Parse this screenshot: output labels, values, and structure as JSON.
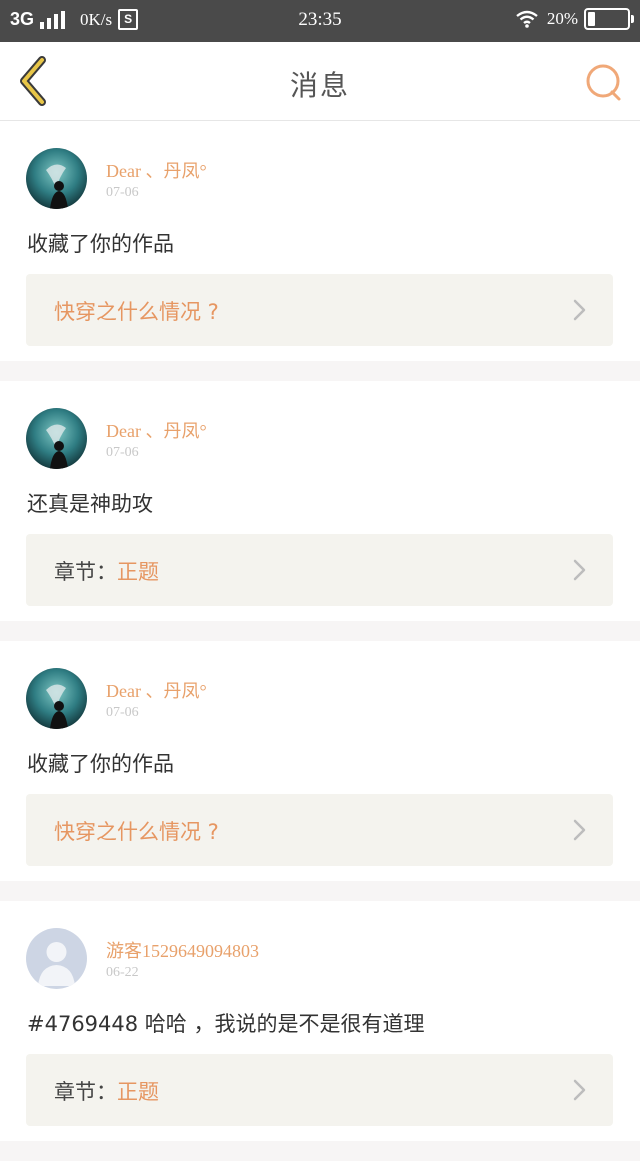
{
  "status_bar": {
    "network": "3G",
    "speed": "0K/s",
    "s_badge": "S",
    "time": "23:35",
    "battery_text": "20%",
    "battery_level": 0.2
  },
  "header": {
    "title": "消息",
    "back_icon": "chevron-left-icon",
    "search_icon": "search-icon"
  },
  "colors": {
    "accent": "#e69661",
    "name_color": "#e8a16b"
  },
  "messages": [
    {
      "user": "Dear 、丹凤°",
      "date": "07-06",
      "avatar": "photo",
      "text": "收藏了你的作品",
      "ref_prefix": "",
      "ref_title": "快穿之什么情况 ?"
    },
    {
      "user": "Dear 、丹凤°",
      "date": "07-06",
      "avatar": "photo",
      "text": "还真是神助攻",
      "ref_prefix": "章节：",
      "ref_title": "正题"
    },
    {
      "user": "Dear 、丹凤°",
      "date": "07-06",
      "avatar": "photo",
      "text": "收藏了你的作品",
      "ref_prefix": "",
      "ref_title": "快穿之什么情况 ?"
    },
    {
      "user": "游客1529649094803",
      "date": "06-22",
      "avatar": "default",
      "text": "#4769448 哈哈 ，我说的是不是很有道理",
      "ref_prefix": "章节：",
      "ref_title": "正题"
    }
  ]
}
